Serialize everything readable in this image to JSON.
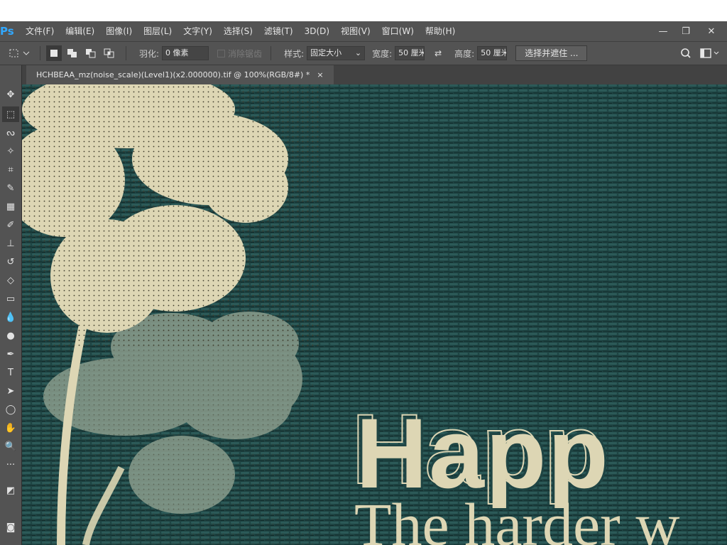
{
  "app": {
    "logo": "Ps"
  },
  "menu": [
    "文件(F)",
    "编辑(E)",
    "图像(I)",
    "图层(L)",
    "文字(Y)",
    "选择(S)",
    "滤镜(T)",
    "3D(D)",
    "视图(V)",
    "窗口(W)",
    "帮助(H)"
  ],
  "window_controls": {
    "minimize": "—",
    "restore": "❐",
    "close": "✕"
  },
  "options": {
    "feather_label": "羽化:",
    "feather_value": "0 像素",
    "antialias_label": "消除锯齿",
    "style_label": "样式:",
    "style_value": "固定大小",
    "width_label": "宽度:",
    "width_value": "50 厘米",
    "height_label": "高度:",
    "height_value": "50 厘米",
    "select_mask_button": "选择并遮住 ..."
  },
  "document_tab": {
    "title": "HCHBEAA_mz(noise_scale)(Level1)(x2.000000).tif @ 100%(RGB/8#) *",
    "close": "×"
  },
  "tools": [
    {
      "name": "move-tool-icon",
      "glyph": "✥"
    },
    {
      "name": "marquee-tool-icon",
      "glyph": "⬚",
      "active": true
    },
    {
      "name": "lasso-tool-icon",
      "glyph": "ᔓ"
    },
    {
      "name": "magic-wand-tool-icon",
      "glyph": "✧"
    },
    {
      "name": "crop-tool-icon",
      "glyph": "⌗"
    },
    {
      "name": "eyedropper-tool-icon",
      "glyph": "✎"
    },
    {
      "name": "healing-brush-tool-icon",
      "glyph": "▦"
    },
    {
      "name": "brush-tool-icon",
      "glyph": "✐"
    },
    {
      "name": "clone-stamp-tool-icon",
      "glyph": "⊥"
    },
    {
      "name": "history-brush-tool-icon",
      "glyph": "↺"
    },
    {
      "name": "eraser-tool-icon",
      "glyph": "◇"
    },
    {
      "name": "gradient-tool-icon",
      "glyph": "▭"
    },
    {
      "name": "blur-tool-icon",
      "glyph": "💧"
    },
    {
      "name": "dodge-tool-icon",
      "glyph": "●"
    },
    {
      "name": "pen-tool-icon",
      "glyph": "✒"
    },
    {
      "name": "type-tool-icon",
      "glyph": "T"
    },
    {
      "name": "path-selection-tool-icon",
      "glyph": "➤"
    },
    {
      "name": "shape-tool-icon",
      "glyph": "◯"
    },
    {
      "name": "hand-tool-icon",
      "glyph": "✋"
    },
    {
      "name": "zoom-tool-icon",
      "glyph": "🔍"
    },
    {
      "name": "more-tools-icon",
      "glyph": "···"
    },
    {
      "name": "color-swatches-icon",
      "glyph": "◩"
    },
    {
      "name": "quick-mask-icon",
      "glyph": "◙"
    }
  ],
  "canvas": {
    "headline": "Happ",
    "subline": "The harder w"
  },
  "colors": {
    "background": "#1f4544",
    "cream": "#ddd6b4",
    "shadow_clover": "#8a9c8c"
  }
}
